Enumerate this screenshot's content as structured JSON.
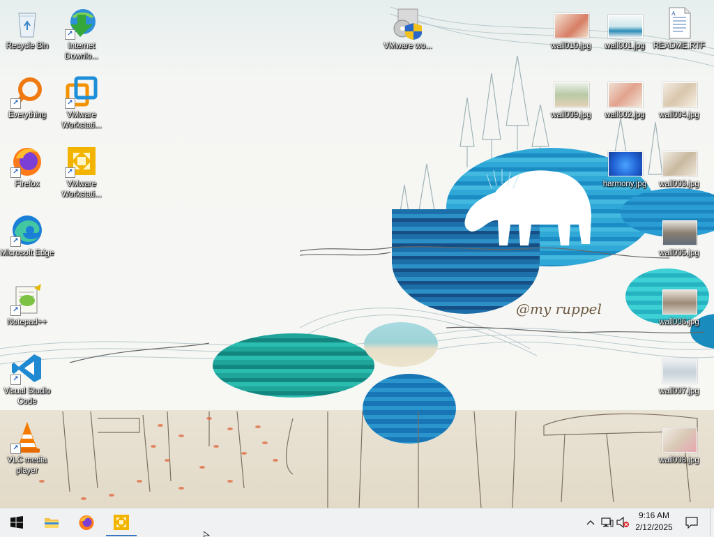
{
  "desktop": {
    "icons_left": [
      {
        "id": "recycle-bin",
        "label": "Recycle Bin"
      },
      {
        "id": "internet-download-manager",
        "label": "Internet Downlo..."
      },
      {
        "id": "everything",
        "label": "Everything"
      },
      {
        "id": "vmware-workstation-1",
        "label": "VMware Workstati..."
      },
      {
        "id": "firefox",
        "label": "Firefox"
      },
      {
        "id": "vmware-workstation-2",
        "label": "VMware Workstati..."
      },
      {
        "id": "microsoft-edge",
        "label": "Microsoft Edge"
      },
      {
        "id": "notepad-plus-plus",
        "label": "Notepad++"
      },
      {
        "id": "visual-studio-code",
        "label": "Visual Studio Code"
      },
      {
        "id": "vlc-media-player",
        "label": "VLC media player"
      }
    ],
    "icons_right": [
      {
        "id": "vmware-wo",
        "label": "VMware wo..."
      },
      {
        "id": "wall010",
        "label": "wall010.jpg"
      },
      {
        "id": "wall001",
        "label": "wall001.jpg"
      },
      {
        "id": "readme",
        "label": "README.RTF"
      },
      {
        "id": "wall009",
        "label": "wall009.jpg"
      },
      {
        "id": "wall002",
        "label": "wall002.jpg"
      },
      {
        "id": "wall004",
        "label": "wall004.jpg"
      },
      {
        "id": "harmony",
        "label": "harmony.jpg"
      },
      {
        "id": "wall003",
        "label": "wall003.jpg"
      },
      {
        "id": "wall005",
        "label": "wall005.jpg"
      },
      {
        "id": "wall006",
        "label": "wall006.jpg"
      },
      {
        "id": "wall007",
        "label": "wall007.jpg"
      },
      {
        "id": "wall008",
        "label": "wall008.jpg"
      }
    ],
    "wallpaper_signature": "@my ruppel"
  },
  "taskbar": {
    "start_icon": "windows-logo-icon",
    "pinned": [
      {
        "id": "file-explorer",
        "icon": "folder-icon"
      },
      {
        "id": "firefox",
        "icon": "firefox-icon"
      },
      {
        "id": "vmware",
        "icon": "vmware-icon",
        "active": true
      }
    ],
    "tray": {
      "show_hidden_icon": "chevron-up-icon",
      "network_icon": "network-icon",
      "volume_icon": "volume-muted-icon",
      "time": "9:16 AM",
      "date": "2/12/2025",
      "notifications_icon": "action-center-icon"
    }
  },
  "colors": {
    "taskbar_bg": "#f0f1f2",
    "accent": "#3a78c3",
    "label_text": "#ffffff"
  }
}
